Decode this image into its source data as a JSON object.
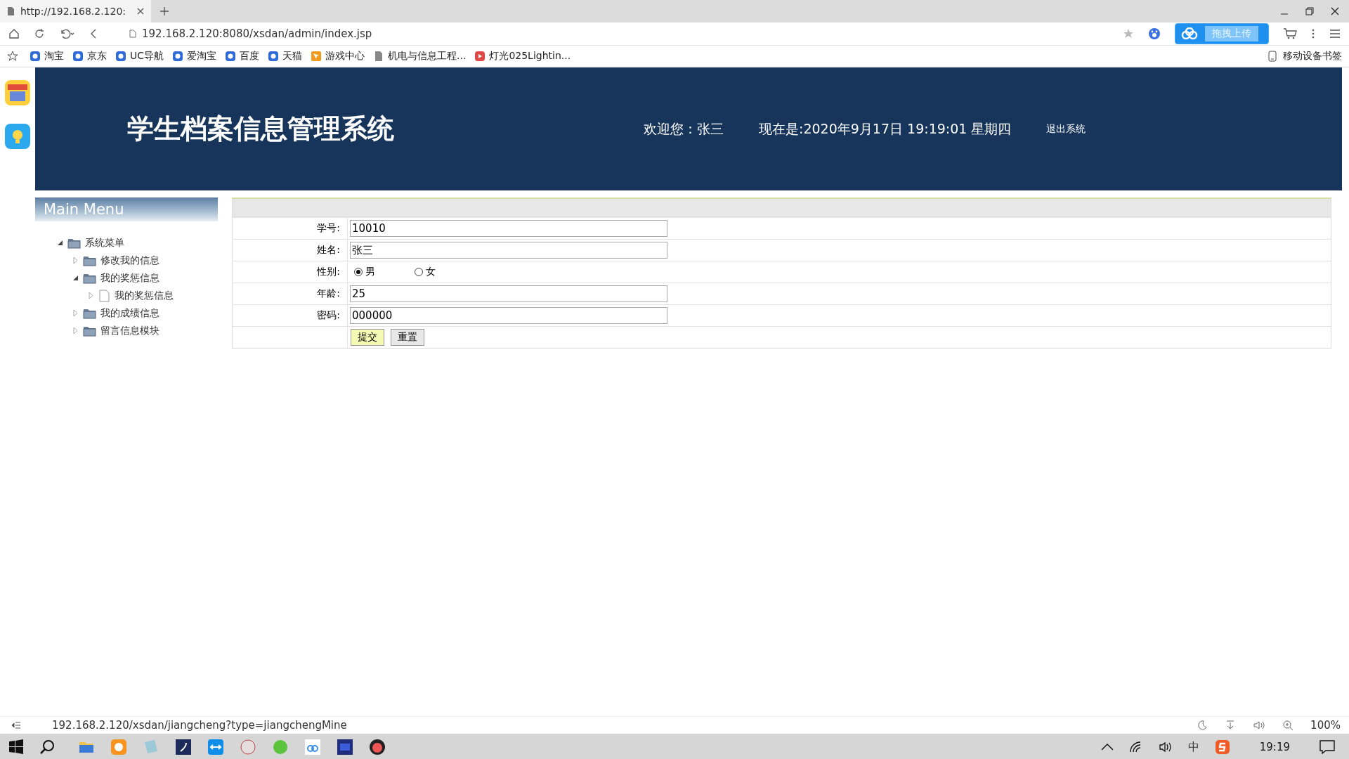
{
  "browser": {
    "tab": {
      "title": "http://192.168.2.120:",
      "selected": true
    },
    "address": "192.168.2.120:8080/xsdan/admin/index.jsp",
    "upload_button": "拖拽上传",
    "bookmarks": [
      {
        "label": "淘宝",
        "kind": "site"
      },
      {
        "label": "京东",
        "kind": "site"
      },
      {
        "label": "UC导航",
        "kind": "site"
      },
      {
        "label": "爱淘宝",
        "kind": "site"
      },
      {
        "label": "百度",
        "kind": "site"
      },
      {
        "label": "天猫",
        "kind": "site"
      },
      {
        "label": "游戏中心",
        "kind": "game"
      },
      {
        "label": "机电与信息工程...",
        "kind": "page"
      },
      {
        "label": "灯光025Lightin...",
        "kind": "video"
      }
    ],
    "mobile_bookmarks": "移动设备书签"
  },
  "header": {
    "title": "学生档案信息管理系统",
    "welcome": "欢迎您：张三",
    "datetime": "现在是:2020年9月17日 19:19:01 星期四",
    "logout": "退出系统"
  },
  "sidebar": {
    "title": "Main Menu",
    "tree": [
      {
        "label": "系统菜单",
        "kind": "folder",
        "expanded": true,
        "children": [
          {
            "label": "修改我的信息",
            "kind": "folder",
            "expanded": false
          },
          {
            "label": "我的奖惩信息",
            "kind": "folder",
            "expanded": true,
            "children": [
              {
                "label": "我的奖惩信息",
                "kind": "file",
                "expanded": false
              }
            ]
          },
          {
            "label": "我的成绩信息",
            "kind": "folder",
            "expanded": false
          },
          {
            "label": "留言信息模块",
            "kind": "folder",
            "expanded": false
          }
        ]
      }
    ]
  },
  "form": {
    "fields": [
      {
        "label": "学号:",
        "kind": "text",
        "value": "10010"
      },
      {
        "label": "姓名:",
        "kind": "text",
        "value": "张三"
      },
      {
        "label": "性别:",
        "kind": "radio",
        "options": [
          {
            "label": "男",
            "selected": true
          },
          {
            "label": "女",
            "selected": false
          }
        ]
      },
      {
        "label": "年龄:",
        "kind": "text",
        "value": "25"
      },
      {
        "label": "密码:",
        "kind": "text",
        "value": "000000"
      }
    ],
    "buttons": [
      {
        "label": "提交",
        "kind": "primary"
      },
      {
        "label": "重置",
        "kind": "plain"
      }
    ]
  },
  "status_bar": {
    "url": "192.168.2.120/xsdan/jiangcheng?type=jiangchengMine",
    "zoom": "100%"
  },
  "taskbar": {
    "time": "19:19",
    "ime": "中"
  }
}
